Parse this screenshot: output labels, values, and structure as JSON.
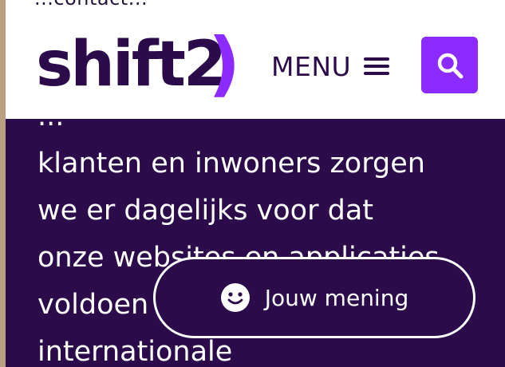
{
  "top_bleed_text": "...contact...",
  "header": {
    "logo_text": "shift2",
    "logo_paren": ")",
    "menu_label": "MENU"
  },
  "content": {
    "lines": [
      "...",
      "klanten en inwoners zorgen",
      "we er dagelijks voor dat",
      "onze websites en applicaties",
      "voldoen aan de",
      "internationale"
    ]
  },
  "feedback": {
    "label": "Jouw mening"
  },
  "colors": {
    "brand_dark": "#2b0b4a",
    "brand_accent": "#8b2bff",
    "white": "#ffffff"
  },
  "icons": {
    "hamburger": "hamburger-icon",
    "search": "search-icon",
    "smiley": "smiley-icon"
  }
}
